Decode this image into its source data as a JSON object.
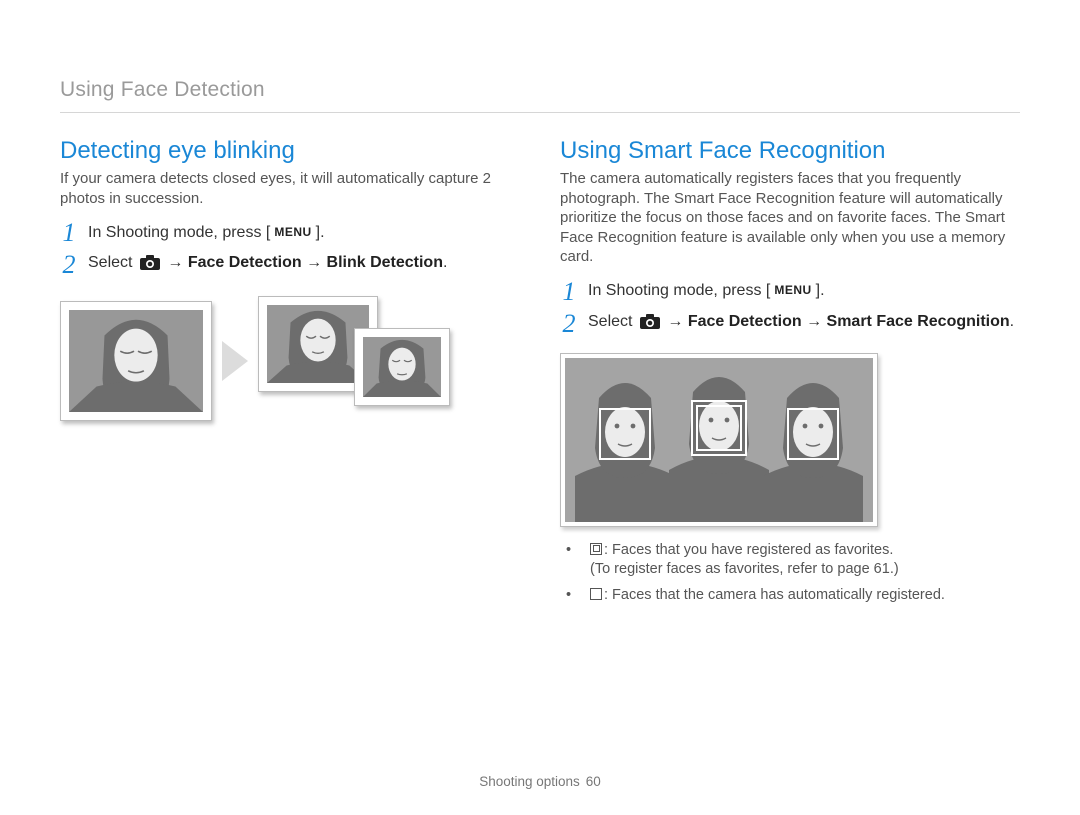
{
  "header": {
    "title": "Using Face Detection"
  },
  "left": {
    "heading": "Detecting eye blinking",
    "para": "If your camera detects closed eyes, it will automatically capture 2 photos in succession.",
    "step1": {
      "num": "1",
      "pre": "In Shooting mode, press [",
      "menu": "MENU",
      "post": "]."
    },
    "step2": {
      "num": "2",
      "select": "Select ",
      "arrow1": " → ",
      "b1": "Face Detection",
      "arrow2": " → ",
      "b2": "Blink Detection",
      "dot": "."
    }
  },
  "right": {
    "heading": "Using Smart Face Recognition",
    "para": "The camera automatically registers faces that you frequently photograph. The Smart Face Recognition feature will automatically prioritize the focus on those faces and on favorite faces. The Smart Face Recognition feature is available only when you use a memory card.",
    "step1": {
      "num": "1",
      "pre": "In Shooting mode, press [",
      "menu": "MENU",
      "post": "]."
    },
    "step2": {
      "num": "2",
      "select": "Select ",
      "arrow1": " → ",
      "b1": "Face Detection",
      "arrow2": " → ",
      "b2": "Smart Face Recognition",
      "dot": "."
    },
    "bullets": {
      "b1a": ": Faces that you have registered as favorites.",
      "b1b": "(To register faces as favorites, refer to page 61.)",
      "b2": ": Faces that the camera has automatically registered."
    }
  },
  "footer": {
    "section": "Shooting options",
    "page": "60"
  }
}
